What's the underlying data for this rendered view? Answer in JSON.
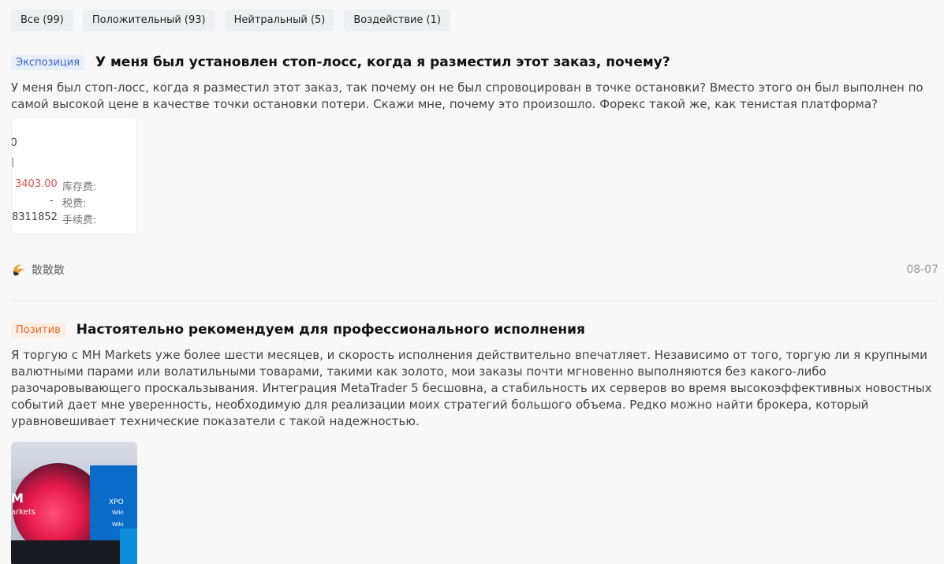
{
  "filters": [
    {
      "label": "Все (99)"
    },
    {
      "label": "Положительный (93)"
    },
    {
      "label": "Нейтральный (5)"
    },
    {
      "label": "Воздействие (1)"
    }
  ],
  "posts": [
    {
      "tag": "Экспозиция",
      "title": "У меня был установлен стоп-лосс, когда я разместил этот заказ, почему?",
      "body": "У меня был стоп-лосс, когда я разместил этот заказ, так почему он не был спровоцирован в точке остановки? Вместо этого он был выполнен по самой высокой цене в качестве точки остановки потери. Скажи мне, почему это произошло. Форекс такой же, как тенистая платформа?",
      "image": {
        "line1": "0",
        "line2": "]",
        "value1": "3403.00",
        "label1": "库存费:",
        "value2": "-",
        "label2": "税费:",
        "value3": "8311852",
        "label3": "手续费:"
      },
      "author": "散散散",
      "date": "08-07"
    },
    {
      "tag": "Позитив",
      "title": "Настоятельно рекомендуем для профессионального исполнения",
      "body": "Я торгую с MH Markets уже более шести месяцев, и скорость исполнения действительно впечатляет. Независимо от того, торгую ли я крупными валютными парами или волатильными товарами, такими как золото, мои заказы почти мгновенно выполняются без какого-либо разочаровывающего проскальзывания. Интеграция MetaTrader 5 бесшовна, а стабильность их серверов во время высокоэффективных новостных событий дает мне уверенность, необходимую для реализации моих стратегий большого объема. Редко можно найти брокера, который уравновешивает технические показатели с такой надежностью.",
      "image": {
        "brand_letter": "M",
        "brand_text": "arkets",
        "expo_text": "XPO",
        "wiki1": "Wiki",
        "wiki2": "Wiki"
      }
    }
  ]
}
